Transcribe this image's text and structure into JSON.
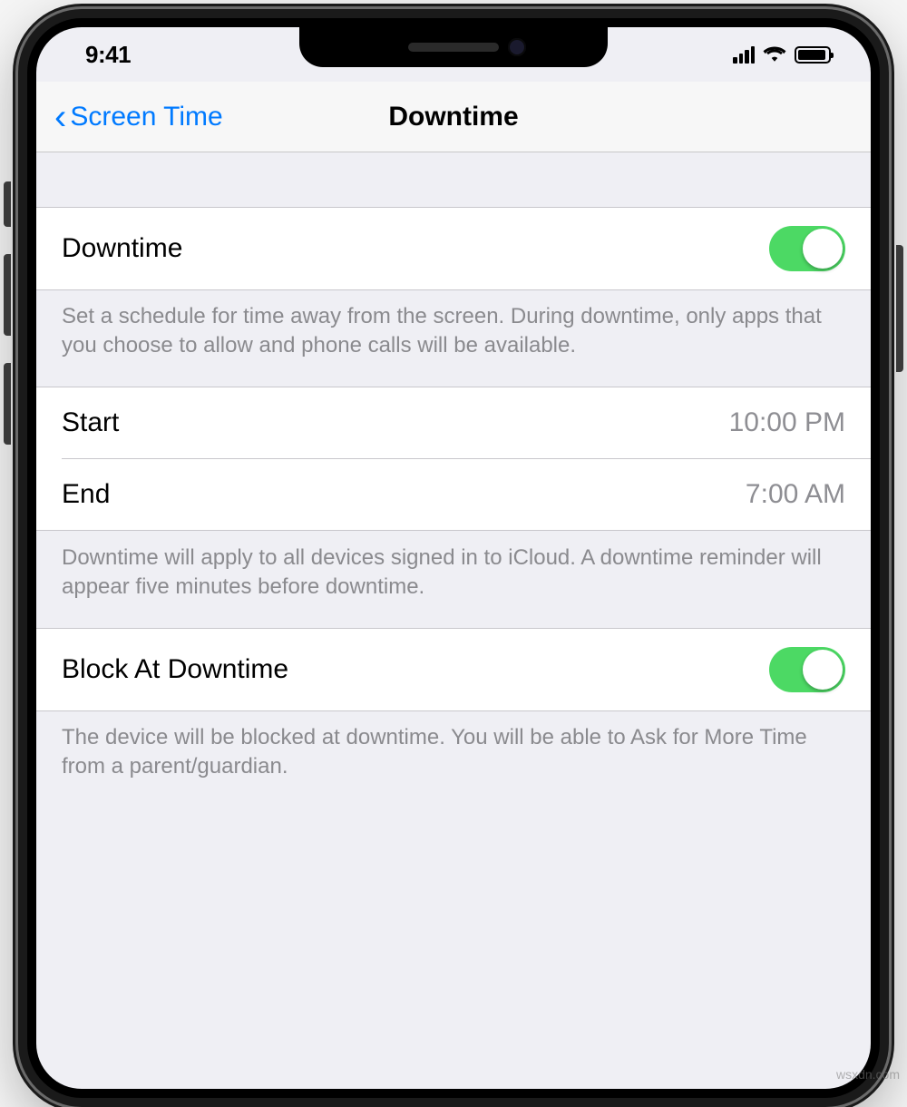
{
  "statusBar": {
    "time": "9:41"
  },
  "nav": {
    "back_label": "Screen Time",
    "title": "Downtime"
  },
  "sections": {
    "downtime": {
      "label": "Downtime",
      "footer": "Set a schedule for time away from the screen. During downtime, only apps that you choose to allow and phone calls will be available."
    },
    "schedule": {
      "start_label": "Start",
      "start_value": "10:00 PM",
      "end_label": "End",
      "end_value": "7:00 AM",
      "footer": "Downtime will apply to all devices signed in to iCloud. A downtime reminder will appear five minutes before downtime."
    },
    "block": {
      "label": "Block At Downtime",
      "footer": "The device will be blocked at downtime. You will be able to Ask for More Time from a parent/guardian."
    }
  },
  "watermark": "wsxdn.com"
}
